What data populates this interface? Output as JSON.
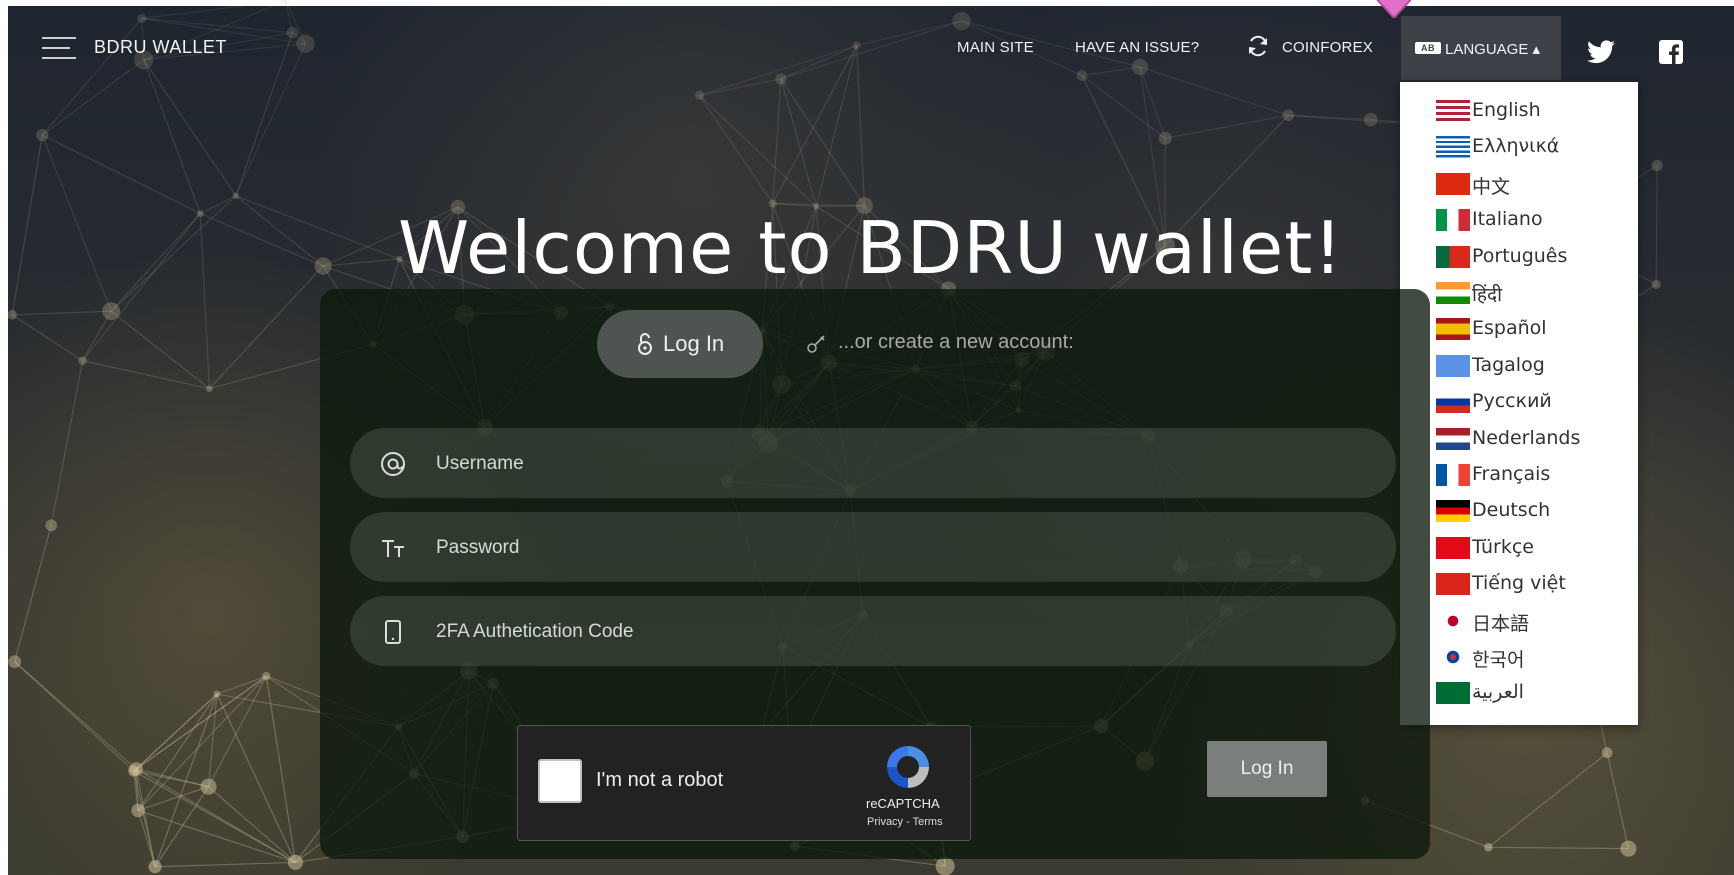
{
  "nav": {
    "brand": "BDRU WALLET",
    "links": [
      "MAIN SITE",
      "HAVE AN ISSUE?",
      "COINFOREX"
    ],
    "language_badge": "AB",
    "language_label": "LANGUAGE ▴"
  },
  "languages": [
    {
      "name": "English",
      "flag": "us-flag"
    },
    {
      "name": "Ελληνικά",
      "flag": "gr-flag"
    },
    {
      "name": "中文",
      "flag": "cn-flag"
    },
    {
      "name": "Italiano",
      "flag": "it-flag"
    },
    {
      "name": "Português",
      "flag": "pt-flag"
    },
    {
      "name": "हिंदी",
      "flag": "in-flag"
    },
    {
      "name": "Español",
      "flag": "es-flag"
    },
    {
      "name": "Tagalog",
      "flag": "un-flag"
    },
    {
      "name": "Русский",
      "flag": "ru-flag"
    },
    {
      "name": "Nederlands",
      "flag": "nl-flag"
    },
    {
      "name": "Français",
      "flag": "fr-flag"
    },
    {
      "name": "Deutsch",
      "flag": "de-flag"
    },
    {
      "name": "Türkçe",
      "flag": "tr-flag"
    },
    {
      "name": "Tiếng việt",
      "flag": "vn-flag"
    },
    {
      "name": "日本語",
      "flag": "jp-flag"
    },
    {
      "name": "한국어",
      "flag": "kr-flag"
    },
    {
      "name": "العربية",
      "flag": "sa-flag"
    }
  ],
  "hero": {
    "title": "Welcome to BDRU wallet!"
  },
  "auth": {
    "login_tab": "Log In",
    "create_text": "...or create a new account:",
    "username_placeholder": "Username",
    "password_placeholder": "Password",
    "twofa_placeholder": "2FA Authetication Code",
    "submit_label": "Log In"
  },
  "captcha": {
    "label": "I'm not a robot",
    "brand": "reCAPTCHA",
    "links": "Privacy - Terms"
  },
  "colors": {
    "panel": "#0c180c",
    "accent_pink": "#e070c8"
  }
}
